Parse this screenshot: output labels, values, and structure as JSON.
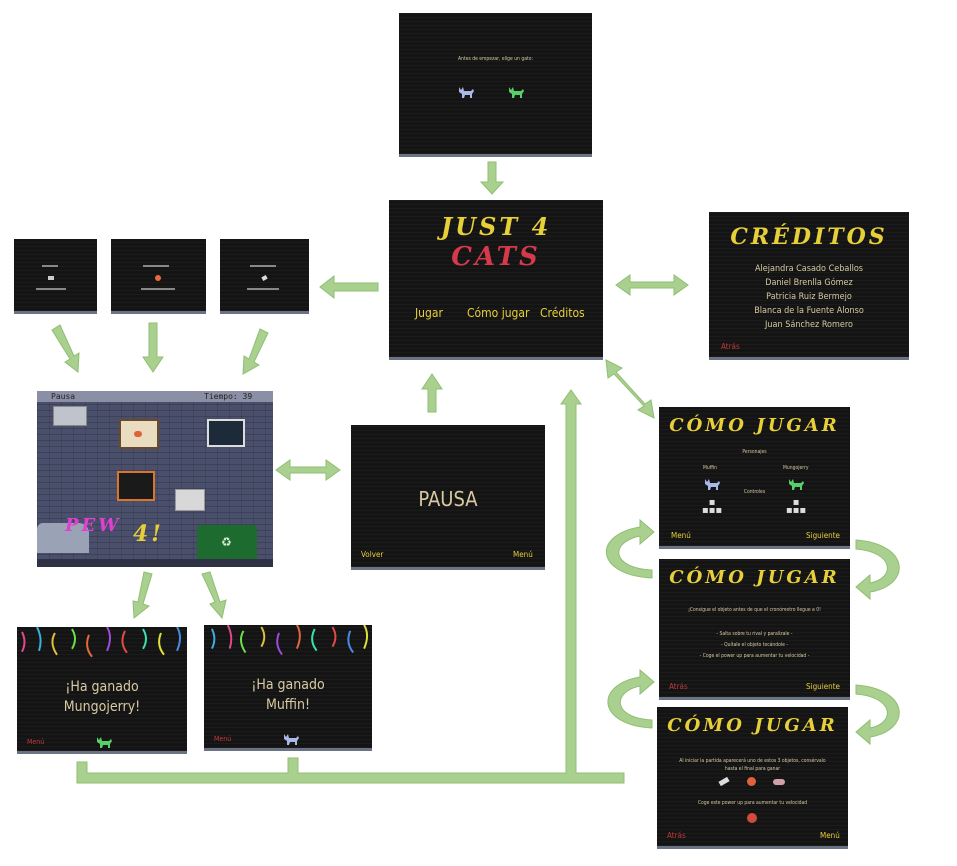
{
  "select_screen": {
    "prompt": "Antes de empezar, elige un gato:"
  },
  "main_menu": {
    "title_line1": "JUST 4",
    "title_line2": "CATS",
    "buttons": [
      "Jugar",
      "Cómo jugar",
      "Créditos"
    ]
  },
  "credits": {
    "title": "CRÉDITOS",
    "names": [
      "Alejandra Casado Ceballos",
      "Daniel Brenlla Gómez",
      "Patricia Ruiz Bermejo",
      "Blanca de la Fuente Alonso",
      "Juan Sánchez Romero"
    ],
    "back": "Atrás"
  },
  "game": {
    "pause": "Pausa",
    "timer": "Tiempo: 39"
  },
  "pause_screen": {
    "title": "PAUSA",
    "back": "Volver",
    "menu": "Menú"
  },
  "win1": {
    "line1": "¡Ha ganado",
    "line2": "Mungojerry!",
    "menu": "Menú"
  },
  "win2": {
    "line1": "¡Ha ganado",
    "line2": "Muffin!",
    "menu": "Menú"
  },
  "howto1": {
    "title": "CÓMO JUGAR",
    "characters": "Personajes",
    "cat1": "Muffin",
    "cat2": "Mungojerry",
    "controls": "Controles",
    "menu": "Menú",
    "next": "Siguiente"
  },
  "howto2": {
    "title": "CÓMO JUGAR",
    "intro": "¡Consigue el objeto antes de que el cronómetro llegue a 0!",
    "tips": [
      "- Salta sobre tu rival y paralízale -",
      "- Quítale el objeto tocándole -",
      "- Coge el power up para aumentar tu velocidad -"
    ],
    "back": "Atrás",
    "next": "Siguiente"
  },
  "howto3": {
    "title": "CÓMO JUGAR",
    "intro_line1": "Al iniciar la partida aparecerá uno de estos 3 objetos, consérvalo",
    "intro_line2": "hasta el final para ganar",
    "powerup": "Coge este power up para aumentar tu velocidad",
    "back": "Atrás",
    "menu": "Menú"
  },
  "colors": {
    "arrow": "#a9d08e",
    "arrow_stroke": "#8fbf73",
    "title_yellow": "#e7cf3a",
    "title_red": "#d43a4a",
    "button_text": "#d8c9a3",
    "accent_red": "#c23a3a"
  }
}
